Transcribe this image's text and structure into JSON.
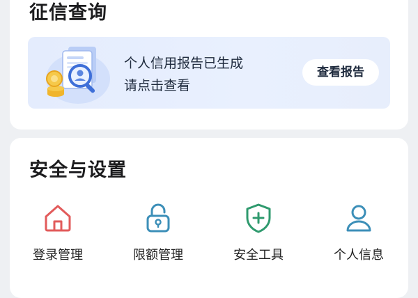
{
  "credit": {
    "title": "征信查询",
    "banner_line1": "个人信用报告已生成",
    "banner_line2": "请点击查看",
    "view_button": "查看报告"
  },
  "security": {
    "title": "安全与设置",
    "items": [
      {
        "label": "登录管理",
        "icon": "home-icon",
        "color": "#e25b5b"
      },
      {
        "label": "限额管理",
        "icon": "lock-icon",
        "color": "#3c8fb8"
      },
      {
        "label": "安全工具",
        "icon": "shield-plus-icon",
        "color": "#2f9a6e"
      },
      {
        "label": "个人信息",
        "icon": "user-icon",
        "color": "#3c8fb8"
      }
    ]
  },
  "colors": {
    "page_bg": "#eef0f3",
    "banner_bg": "#e6eefd",
    "text_primary": "#1c1c1e"
  }
}
